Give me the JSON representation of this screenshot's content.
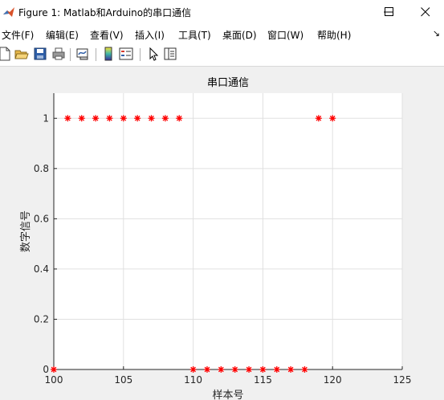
{
  "window": {
    "title": "Figure 1: Matlab和Arduino的串口通信"
  },
  "menu": {
    "items": [
      {
        "label": "文件(F)"
      },
      {
        "label": "编辑(E)"
      },
      {
        "label": "查看(V)"
      },
      {
        "label": "插入(I)"
      },
      {
        "label": "工具(T)"
      },
      {
        "label": "桌面(D)"
      },
      {
        "label": "窗口(W)"
      },
      {
        "label": "帮助(H)"
      }
    ]
  },
  "toolbar": {
    "icons": [
      "new-figure-icon",
      "open-file-icon",
      "save-icon",
      "print-icon",
      "link-plot-icon",
      "colorbar-icon",
      "legend-icon",
      "pointer-icon",
      "property-inspector-icon"
    ]
  },
  "colors": {
    "marker": "#ff0000",
    "grid": "#e0e0e0",
    "axes": "#262626"
  },
  "chart_data": {
    "type": "scatter",
    "title": "串口通信",
    "xlabel": "样本号",
    "ylabel": "数字信号",
    "xlim": [
      100,
      125
    ],
    "ylim": [
      0,
      1.1
    ],
    "xticks": [
      "100",
      "105",
      "110",
      "115",
      "120",
      "125"
    ],
    "yticks": [
      "0",
      "0.2",
      "0.4",
      "0.6",
      "0.8",
      "1"
    ],
    "grid": true,
    "marker": "*",
    "series": [
      {
        "x": [
          100,
          101,
          102,
          103,
          104,
          105,
          106,
          107,
          108,
          109,
          110,
          111,
          112,
          113,
          114,
          115,
          116,
          117,
          118,
          119,
          120
        ],
        "y": [
          0,
          1,
          1,
          1,
          1,
          1,
          1,
          1,
          1,
          1,
          0,
          0,
          0,
          0,
          0,
          0,
          0,
          0,
          0,
          1,
          1
        ]
      }
    ]
  }
}
